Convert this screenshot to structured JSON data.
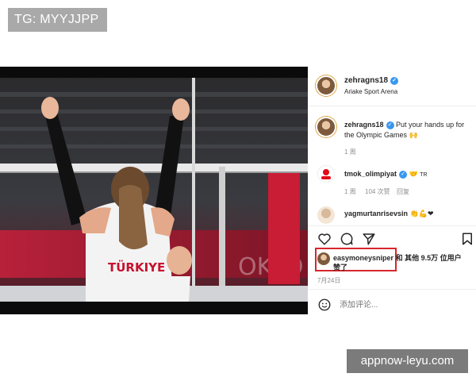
{
  "watermark_top": "TG: MYYJJPP",
  "watermark_bottom": "appnow-leyu.com",
  "post": {
    "author": "zehragns18",
    "location": "Ariake Sport Arena",
    "caption_author": "zehragns18",
    "caption_text": "Put your hands up for the Olympic Games",
    "caption_time": "1 周",
    "jersey_text": "TÜRKIYE",
    "comments": [
      {
        "user": "tmok_olimpiyat",
        "text": "TR",
        "time": "1 周",
        "likes": "104 次赞",
        "reply": "回复"
      },
      {
        "user": "yagmurtanrisevsin",
        "text": ""
      }
    ],
    "liked_by_user": "easymoneysniper",
    "liked_by_suffix": "和 其他 9.5万 位用户",
    "liked_by_line2": "赞了",
    "date": "7月24日",
    "comment_placeholder": "添加评论..."
  },
  "colors": {
    "verified": "#3897f0",
    "highlight_box": "#d8262d",
    "jersey_red": "#c8102e"
  },
  "icons": [
    "heart-icon",
    "comment-icon",
    "share-icon",
    "bookmark-icon",
    "emoji-icon",
    "verified-icon"
  ]
}
